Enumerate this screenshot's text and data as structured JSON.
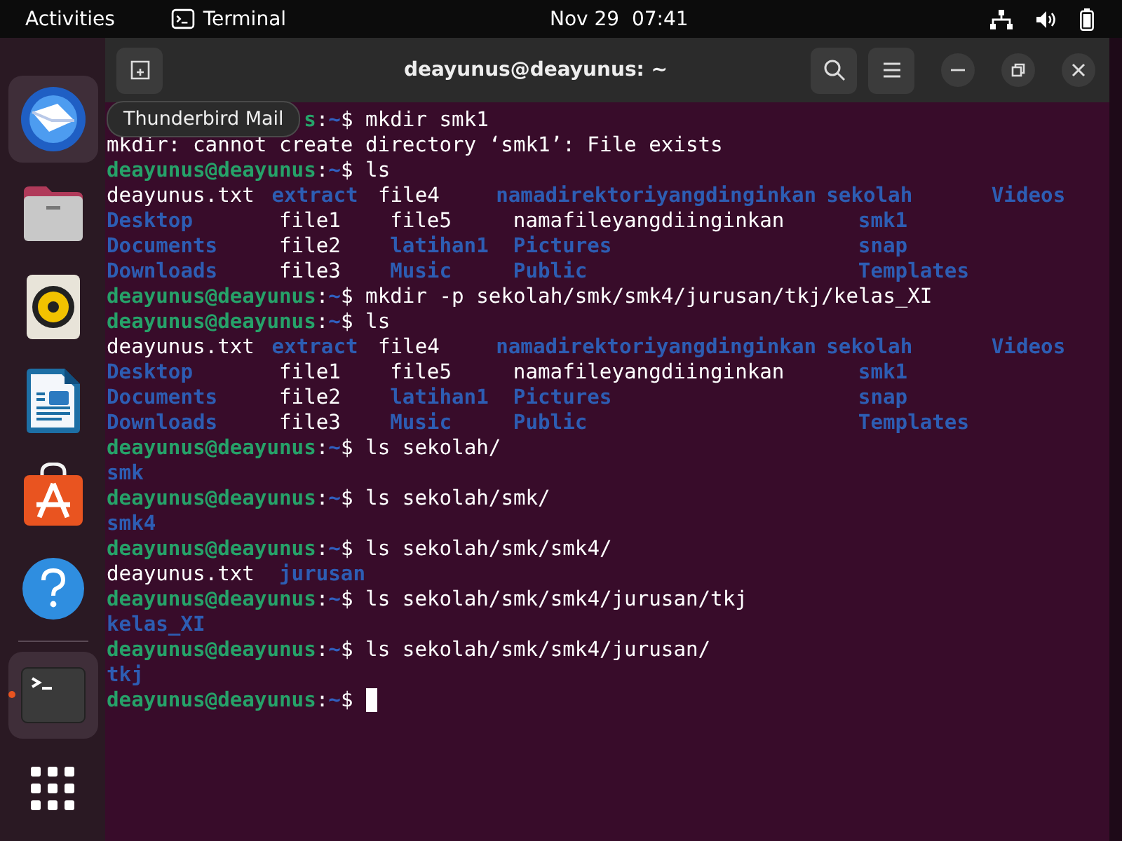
{
  "top_bar": {
    "activities": "Activities",
    "app_name": "Terminal",
    "clock": "Nov 29  07:41"
  },
  "dock": {
    "items": [
      {
        "kind": "mail",
        "highlighted": true,
        "running": false
      },
      {
        "kind": "files",
        "highlighted": false,
        "running": false
      },
      {
        "kind": "music",
        "highlighted": false,
        "running": false
      },
      {
        "kind": "writer",
        "highlighted": false,
        "running": false
      },
      {
        "kind": "store",
        "highlighted": false,
        "running": false
      },
      {
        "kind": "help",
        "highlighted": false,
        "running": false
      },
      {
        "kind": "terminal",
        "highlighted": true,
        "running": true
      },
      {
        "kind": "apps",
        "highlighted": false,
        "running": false
      }
    ],
    "tooltip": "Thunderbird Mail"
  },
  "window": {
    "title": "deayunus@deayunus: ~"
  },
  "terminal": {
    "lines": [
      {
        "kind": "prompt",
        "user": "s",
        "sep": ":",
        "path": "~",
        "sign": "$",
        "command": "mkdir smk1"
      },
      {
        "kind": "text",
        "text": "mkdir: cannot create directory ‘smk1’: File exists"
      },
      {
        "kind": "prompt",
        "user": "deayunus@deayunus",
        "sep": ":",
        "path": "~",
        "sign": "$",
        "command": "ls"
      },
      {
        "kind": "listing",
        "entries": [
          {
            "text": "deayunus.txt",
            "dir": false
          },
          {
            "text": "extract",
            "dir": true
          },
          {
            "text": "file4",
            "dir": false
          },
          {
            "text": "namadirektoriyangdinginkan",
            "dir": true
          },
          {
            "text": "sekolah",
            "dir": true
          },
          {
            "text": "Videos",
            "dir": true
          }
        ]
      },
      {
        "kind": "listing",
        "entries": [
          {
            "text": "Desktop",
            "dir": true
          },
          {
            "text": "file1",
            "dir": false
          },
          {
            "text": "file5",
            "dir": false
          },
          {
            "text": "namafileyangdiinginkan",
            "dir": false
          },
          {
            "text": "smk1",
            "dir": true
          }
        ]
      },
      {
        "kind": "listing",
        "entries": [
          {
            "text": "Documents",
            "dir": true
          },
          {
            "text": "file2",
            "dir": false
          },
          {
            "text": "latihan1",
            "dir": true
          },
          {
            "text": "Pictures",
            "dir": true
          },
          {
            "text": "snap",
            "dir": true
          }
        ]
      },
      {
        "kind": "listing",
        "entries": [
          {
            "text": "Downloads",
            "dir": true
          },
          {
            "text": "file3",
            "dir": false
          },
          {
            "text": "Music",
            "dir": true
          },
          {
            "text": "Public",
            "dir": true
          },
          {
            "text": "Templates",
            "dir": true
          }
        ]
      },
      {
        "kind": "prompt",
        "user": "deayunus@deayunus",
        "sep": ":",
        "path": "~",
        "sign": "$",
        "command": "mkdir -p sekolah/smk/smk4/jurusan/tkj/kelas_XI"
      },
      {
        "kind": "prompt",
        "user": "deayunus@deayunus",
        "sep": ":",
        "path": "~",
        "sign": "$",
        "command": "ls"
      },
      {
        "kind": "listing",
        "entries": [
          {
            "text": "deayunus.txt",
            "dir": false
          },
          {
            "text": "extract",
            "dir": true
          },
          {
            "text": "file4",
            "dir": false
          },
          {
            "text": "namadirektoriyangdinginkan",
            "dir": true
          },
          {
            "text": "sekolah",
            "dir": true
          },
          {
            "text": "Videos",
            "dir": true
          }
        ]
      },
      {
        "kind": "listing",
        "entries": [
          {
            "text": "Desktop",
            "dir": true
          },
          {
            "text": "file1",
            "dir": false
          },
          {
            "text": "file5",
            "dir": false
          },
          {
            "text": "namafileyangdiinginkan",
            "dir": false
          },
          {
            "text": "smk1",
            "dir": true
          }
        ]
      },
      {
        "kind": "listing",
        "entries": [
          {
            "text": "Documents",
            "dir": true
          },
          {
            "text": "file2",
            "dir": false
          },
          {
            "text": "latihan1",
            "dir": true
          },
          {
            "text": "Pictures",
            "dir": true
          },
          {
            "text": "snap",
            "dir": true
          }
        ]
      },
      {
        "kind": "listing",
        "entries": [
          {
            "text": "Downloads",
            "dir": true
          },
          {
            "text": "file3",
            "dir": false
          },
          {
            "text": "Music",
            "dir": true
          },
          {
            "text": "Public",
            "dir": true
          },
          {
            "text": "Templates",
            "dir": true
          }
        ]
      },
      {
        "kind": "prompt",
        "user": "deayunus@deayunus",
        "sep": ":",
        "path": "~",
        "sign": "$",
        "command": "ls sekolah/"
      },
      {
        "kind": "listing",
        "entries": [
          {
            "text": "smk",
            "dir": true
          }
        ]
      },
      {
        "kind": "prompt",
        "user": "deayunus@deayunus",
        "sep": ":",
        "path": "~",
        "sign": "$",
        "command": "ls sekolah/smk/"
      },
      {
        "kind": "listing",
        "entries": [
          {
            "text": "smk4",
            "dir": true
          }
        ]
      },
      {
        "kind": "prompt",
        "user": "deayunus@deayunus",
        "sep": ":",
        "path": "~",
        "sign": "$",
        "command": "ls sekolah/smk/smk4/"
      },
      {
        "kind": "listing",
        "entries": [
          {
            "text": "deayunus.txt",
            "dir": false
          },
          {
            "text": "jurusan",
            "dir": true
          }
        ]
      },
      {
        "kind": "prompt",
        "user": "deayunus@deayunus",
        "sep": ":",
        "path": "~",
        "sign": "$",
        "command": "ls sekolah/smk/smk4/jurusan/tkj"
      },
      {
        "kind": "listing",
        "entries": [
          {
            "text": "kelas_XI",
            "dir": true
          }
        ]
      },
      {
        "kind": "prompt",
        "user": "deayunus@deayunus",
        "sep": ":",
        "path": "~",
        "sign": "$",
        "command": "ls sekolah/smk/smk4/jurusan/"
      },
      {
        "kind": "listing",
        "entries": [
          {
            "text": "tkj",
            "dir": true
          }
        ]
      },
      {
        "kind": "prompt",
        "user": "deayunus@deayunus",
        "sep": ":",
        "path": "~",
        "sign": "$",
        "cursor": true
      }
    ]
  }
}
